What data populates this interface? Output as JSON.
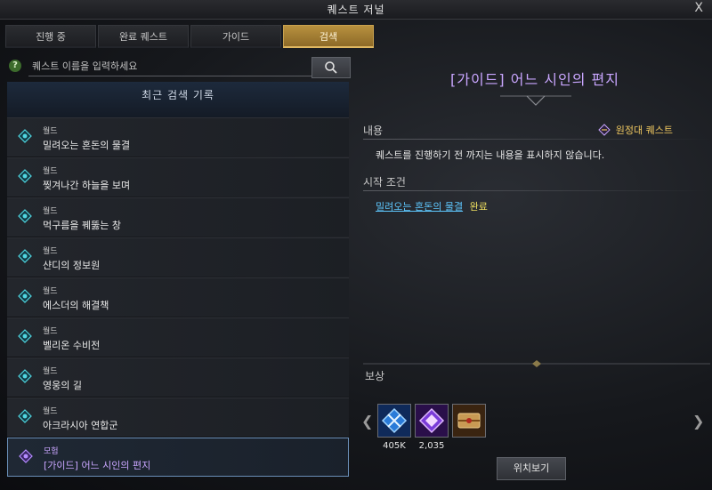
{
  "window": {
    "title": "퀘스트 저널",
    "close_label": "X"
  },
  "tabs": [
    {
      "label": "진행 중",
      "active": false
    },
    {
      "label": "완료 퀘스트",
      "active": false
    },
    {
      "label": "가이드",
      "active": false
    },
    {
      "label": "검색",
      "active": true
    }
  ],
  "search": {
    "help_label": "?",
    "placeholder": "퀘스트 이름을 입력하세요",
    "value": ""
  },
  "recent": {
    "header": "최근 검색 기록",
    "items": [
      {
        "category": "월드",
        "name": "밀려오는 혼돈의 물결",
        "icon": "world-quest-icon"
      },
      {
        "category": "월드",
        "name": "찢겨나간 하늘을 보며",
        "icon": "world-quest-icon"
      },
      {
        "category": "월드",
        "name": "먹구름을 꿰뚫는 창",
        "icon": "world-quest-icon"
      },
      {
        "category": "월드",
        "name": "샨디의 정보원",
        "icon": "world-quest-icon"
      },
      {
        "category": "월드",
        "name": "에스더의 해결책",
        "icon": "world-quest-icon"
      },
      {
        "category": "월드",
        "name": "벨리온 수비전",
        "icon": "world-quest-icon"
      },
      {
        "category": "월드",
        "name": "영웅의 길",
        "icon": "world-quest-icon"
      },
      {
        "category": "월드",
        "name": "아크라시아 연합군",
        "icon": "world-quest-icon"
      },
      {
        "category": "모험",
        "name": "[가이드] 어느 시인의 편지",
        "icon": "adventure-quest-icon"
      }
    ]
  },
  "detail": {
    "title": "[가이드] 어느 시인의 편지",
    "content_label": "내용",
    "badge_label": "원정대 퀘스트",
    "description": "퀘스트를 진행하기 전 까지는 내용을 표시하지 않습니다.",
    "start_condition_label": "시작 조건",
    "condition_quest": "밀려오는 혼돈의 물결",
    "condition_status": "완료",
    "reward_label": "보상",
    "rewards": [
      {
        "icon": "blue-crystal-icon",
        "amount": "405K"
      },
      {
        "icon": "purple-crystal-icon",
        "amount": "2,035"
      },
      {
        "icon": "scroll-chest-icon",
        "amount": ""
      }
    ],
    "locate_button": "위치보기"
  },
  "colors": {
    "accent_gold": "#c9a24f",
    "quest_purple": "#c9a6ff",
    "link_blue": "#5ec8ff",
    "done_yellow": "#f0e060"
  }
}
